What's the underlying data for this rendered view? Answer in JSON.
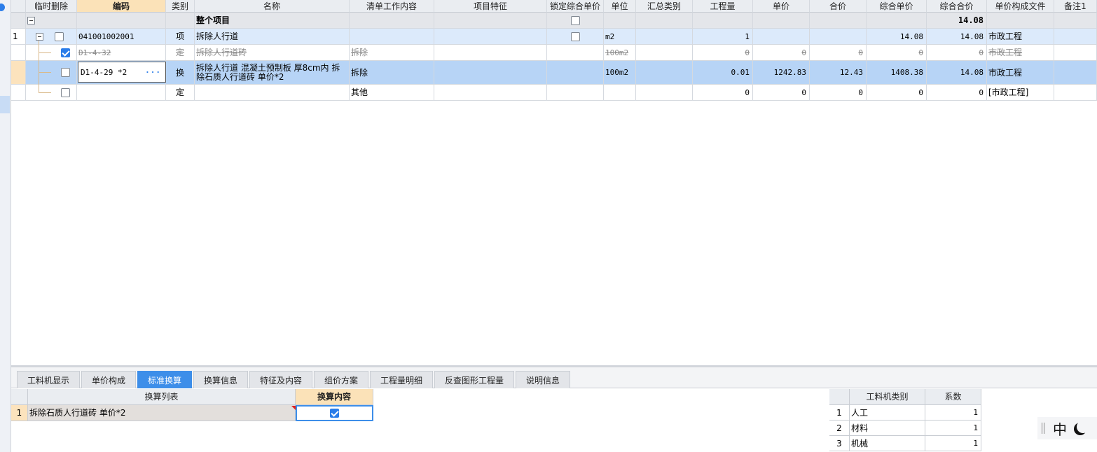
{
  "columns": [
    {
      "key": "temp_delete",
      "label": "临时删除"
    },
    {
      "key": "code",
      "label": "编码"
    },
    {
      "key": "type",
      "label": "类别"
    },
    {
      "key": "name",
      "label": "名称"
    },
    {
      "key": "work_content",
      "label": "清单工作内容"
    },
    {
      "key": "feature",
      "label": "项目特征"
    },
    {
      "key": "lock_price",
      "label": "锁定综合单价"
    },
    {
      "key": "unit",
      "label": "单位"
    },
    {
      "key": "summary_type",
      "label": "汇总类别"
    },
    {
      "key": "quantity",
      "label": "工程量"
    },
    {
      "key": "unit_price",
      "label": "单价"
    },
    {
      "key": "total",
      "label": "合价"
    },
    {
      "key": "comp_unit_price",
      "label": "综合单价"
    },
    {
      "key": "comp_total",
      "label": "综合合价"
    },
    {
      "key": "price_file",
      "label": "单价构成文件"
    },
    {
      "key": "remark",
      "label": "备注1"
    }
  ],
  "project_row": {
    "name": "整个项目",
    "comp_total": "14.08"
  },
  "rows": [
    {
      "index": "1",
      "code": "041001002001",
      "type": "项",
      "name": "拆除人行道",
      "work_content": "",
      "unit": "m2",
      "quantity": "1",
      "unit_price": "",
      "total": "",
      "comp_unit_price": "14.08",
      "comp_total": "14.08",
      "price_file": "市政工程",
      "checked": false,
      "lock_checked": false
    },
    {
      "index": "",
      "code": "D1-4-32",
      "type": "定",
      "name": "拆除人行道砖",
      "work_content": "拆除",
      "unit": "100m2",
      "quantity": "0",
      "unit_price": "0",
      "total": "0",
      "comp_unit_price": "0",
      "comp_total": "0",
      "price_file": "市政工程",
      "checked": true,
      "struck": true
    },
    {
      "index": "",
      "code": "D1-4-29 *2",
      "type": "换",
      "name": "拆除人行道 混凝土预制板 厚8cm内  拆除石质人行道砖 单价*2",
      "work_content": "拆除",
      "unit": "100m2",
      "quantity": "0.01",
      "unit_price": "1242.83",
      "total": "12.43",
      "comp_unit_price": "1408.38",
      "comp_total": "14.08",
      "price_file": "市政工程",
      "checked": false
    },
    {
      "index": "",
      "code": "",
      "type": "定",
      "name": "",
      "work_content": "其他",
      "unit": "",
      "quantity": "0",
      "unit_price": "0",
      "total": "0",
      "comp_unit_price": "0",
      "comp_total": "0",
      "price_file": "[市政工程]",
      "checked": false
    }
  ],
  "tabs": [
    {
      "label": "工料机显示"
    },
    {
      "label": "单价构成"
    },
    {
      "label": "标准换算",
      "active": true
    },
    {
      "label": "换算信息"
    },
    {
      "label": "特征及内容"
    },
    {
      "label": "组价方案"
    },
    {
      "label": "工程量明细"
    },
    {
      "label": "反查图形工程量"
    },
    {
      "label": "说明信息"
    }
  ],
  "conversion": {
    "headers": [
      "换算列表",
      "换算内容"
    ],
    "rows": [
      {
        "index": "1",
        "name": "拆除石质人行道砖 单价*2",
        "checked": true
      }
    ]
  },
  "factors": {
    "headers": [
      "工料机类别",
      "系数"
    ],
    "rows": [
      {
        "index": "1",
        "category": "人工",
        "factor": "1"
      },
      {
        "index": "2",
        "category": "材料",
        "factor": "1"
      },
      {
        "index": "3",
        "category": "机械",
        "factor": "1"
      }
    ]
  },
  "ime": {
    "mode": "中"
  },
  "colors": {
    "accent": "#3d8ee9",
    "selected_row": "#b7d4f6",
    "header_selected": "#fbe2b8"
  }
}
